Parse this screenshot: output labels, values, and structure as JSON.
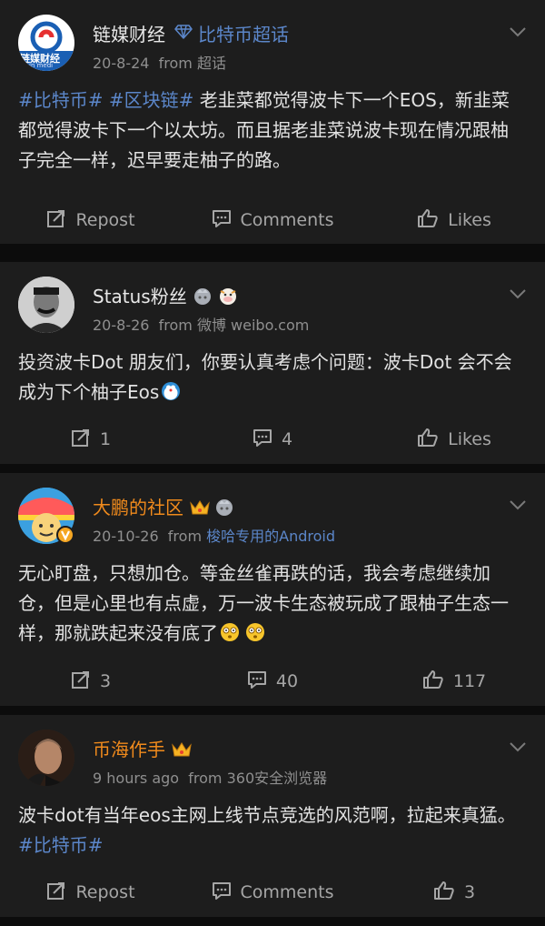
{
  "posts": [
    {
      "author": "链媒财经",
      "topic_tag": "比特币超话",
      "date": "20-8-24",
      "from_prefix": "from",
      "source": "超话",
      "content_tags": "#比特币# #区块链#",
      "content": " 老韭菜都觉得波卡下一个EOS，新韭菜都觉得波卡下一个以太坊。而且据老韭菜说波卡现在情况跟柚子完全一样，迟早要走柚子的路。",
      "repost": "Repost",
      "comments": "Comments",
      "likes": "Likes",
      "avatar_text": "链媒财经",
      "avatar_subtext": "in medi"
    },
    {
      "author": "Status粉丝",
      "date": "20-8-26",
      "from_prefix": "from",
      "source": "微博 weibo.com",
      "content": "投资波卡Dot 朋友们，你要认真考虑个问题：波卡Dot 会不会成为下个柚子Eos",
      "repost": "1",
      "comments": "4",
      "likes": "Likes"
    },
    {
      "author": "大鹏的社区",
      "date": "20-10-26",
      "from_prefix": "from",
      "source": "梭哈专用的Android",
      "content": "无心盯盘，只想加仓。等金丝雀再跌的话，我会考虑继续加仓，但是心里也有点虚，万一波卡生态被玩成了跟柚子生态一样，那就跌起来没有底了",
      "repost": "3",
      "comments": "40",
      "likes": "117"
    },
    {
      "author": "币海作手",
      "date": "9 hours ago",
      "from_prefix": "from",
      "source": "360安全浏览器",
      "content": "波卡dot有当年eos主网上线节点竞选的风范啊，拉起来真猛。",
      "content_tag_end": "#比特币#",
      "repost": "Repost",
      "comments": "Comments",
      "likes": "3"
    }
  ],
  "colors": {
    "background": "#0c0c0c",
    "card": "#1d1d1d",
    "link_blue": "#5b86c9",
    "vip_orange": "#f08a1c",
    "meta_grey": "#8f8f8f"
  }
}
